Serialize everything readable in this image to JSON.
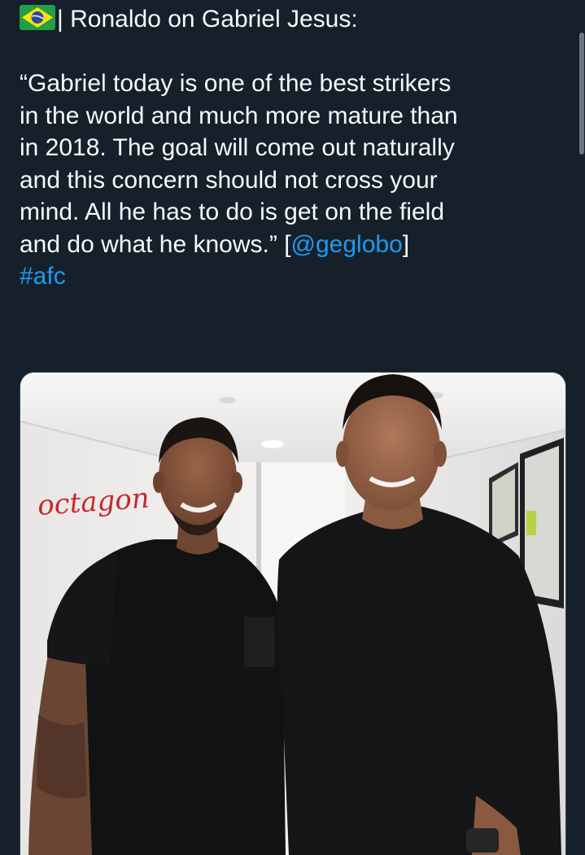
{
  "tweet": {
    "flag_icon": "brazil-flag-icon",
    "heading": "| Ronaldo on Gabriel Jesus:",
    "quote_lines": [
      "“Gabriel today is one of the best strikers",
      "in the world and much more mature than",
      "in 2018. The goal will come out naturally",
      "and this concern should not cross your",
      "mind. All he has to do is get on the field"
    ],
    "last_line_text": "and do what he knows.” [",
    "mention": "@geglobo",
    "last_line_close": "]",
    "hashtag": "#afc"
  },
  "media": {
    "wall_sign": "octagon"
  },
  "colors": {
    "background": "#15202b",
    "text": "#f7f9f9",
    "link": "#1d9bf0"
  }
}
